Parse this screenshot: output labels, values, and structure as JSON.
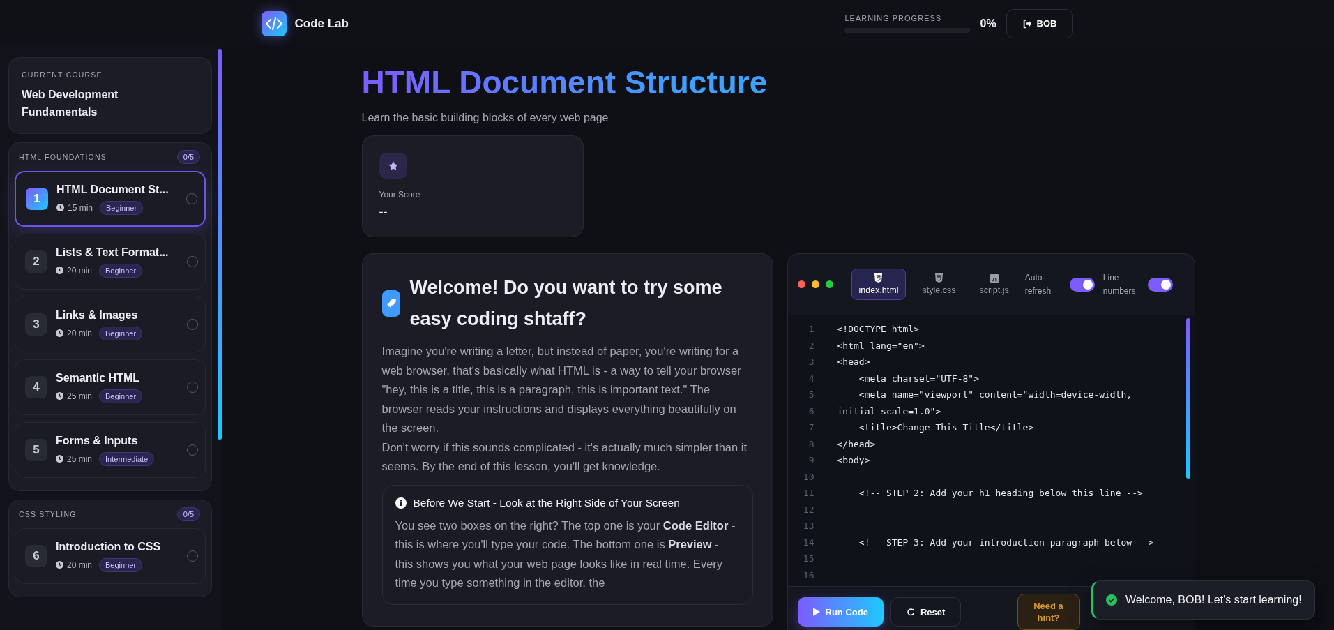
{
  "header": {
    "logo": "Code Lab",
    "progress": {
      "label": "LEARNING PROGRESS",
      "level": 0,
      "value": "0%"
    },
    "user_button": "BOB"
  },
  "sidebar": {
    "current_course": {
      "label": "CURRENT COURSE",
      "title": "Web Development Fundamentals"
    },
    "sections": [
      {
        "title": "HTML FOUNDATIONS",
        "count": "0/5",
        "lessons": [
          {
            "number": "1",
            "title": "HTML Document St...",
            "duration": "15 min",
            "level": "Beginner",
            "selected": true,
            "completed": false
          },
          {
            "number": "2",
            "title": "Lists & Text Format...",
            "duration": "20 min",
            "level": "Beginner",
            "selected": false,
            "completed": false
          },
          {
            "number": "3",
            "title": "Links & Images",
            "duration": "20 min",
            "level": "Beginner",
            "selected": false,
            "completed": false
          },
          {
            "number": "4",
            "title": "Semantic HTML",
            "duration": "25 min",
            "level": "Beginner",
            "selected": false,
            "completed": false
          },
          {
            "number": "5",
            "title": "Forms & Inputs",
            "duration": "25 min",
            "level": "Intermediate",
            "selected": false,
            "completed": false
          }
        ]
      },
      {
        "title": "CSS STYLING",
        "count": "0/5",
        "lessons": [
          {
            "number": "6",
            "title": "Introduction to CSS",
            "duration": "20 min",
            "level": "Beginner",
            "selected": false,
            "completed": false
          }
        ]
      }
    ]
  },
  "page": {
    "title": "HTML Document Structure",
    "subtitle": "Learn the basic building blocks of every web page",
    "score": {
      "label": "Your Score",
      "value": "--"
    }
  },
  "lesson": {
    "heading": "Welcome! Do you want to try some easy coding shtaff?",
    "paragraphs": [
      "Imagine you're writing a letter, but instead of paper, you're writing for a web browser, that's basically what HTML is - a way to tell your browser \"hey, this is a title, this is a paragraph, this is important text.\" The browser reads your instructions and displays everything beautifully on the screen.",
      "Don't worry if this sounds complicated - it's actually much simpler than it seems. By the end of this lesson, you'll get knowledge."
    ],
    "info": {
      "title": "Before We Start - Look at the Right Side of Your Screen",
      "text": "You see two boxes on the right? The top one is your **Code Editor** - this is where you'll type your code. The bottom one is **Preview** - this shows you what your web page looks like in real time. Every time you type something in the editor, the"
    }
  },
  "editor": {
    "tabs": [
      {
        "label": "index.html",
        "kind": "html",
        "selected": true
      },
      {
        "label": "style.css",
        "kind": "css",
        "selected": false
      },
      {
        "label": "script.js",
        "kind": "js",
        "selected": false
      }
    ],
    "toggles": [
      {
        "label": "Auto-refresh",
        "on": true
      },
      {
        "label": "Line numbers",
        "on": true
      }
    ],
    "lines": [
      {
        "number": "1",
        "code": "<!DOCTYPE html>"
      },
      {
        "number": "2",
        "code": "<html lang=\"en\">"
      },
      {
        "number": "3",
        "code": "<head>"
      },
      {
        "number": "4",
        "code": "    <meta charset=\"UTF-8\">"
      },
      {
        "number": "5",
        "code": "    <meta name=\"viewport\" content=\"width=device-width,"
      },
      {
        "number": "6",
        "code": "initial-scale=1.0\">"
      },
      {
        "number": "7",
        "code": "    <title>Change This Title</title>"
      },
      {
        "number": "8",
        "code": "</head>"
      },
      {
        "number": "9",
        "code": "<body>"
      },
      {
        "number": "10"
      },
      {
        "number": "11",
        "code": "    <!-- STEP 2: Add your h1 heading below this line -->"
      },
      {
        "number": "12"
      },
      {
        "number": "13"
      },
      {
        "number": "14",
        "code": "    <!-- STEP 3: Add your introduction paragraph below -->"
      },
      {
        "number": "15"
      },
      {
        "number": "16"
      }
    ],
    "buttons": [
      {
        "label": "Run Code",
        "kind": "primary"
      },
      {
        "label": "Reset",
        "kind": "secondary"
      },
      {
        "label": "Need a hint?",
        "kind": "hint"
      }
    ]
  },
  "toast": {
    "message": "Welcome, BOB! Let's start learning!",
    "kind": "success"
  }
}
